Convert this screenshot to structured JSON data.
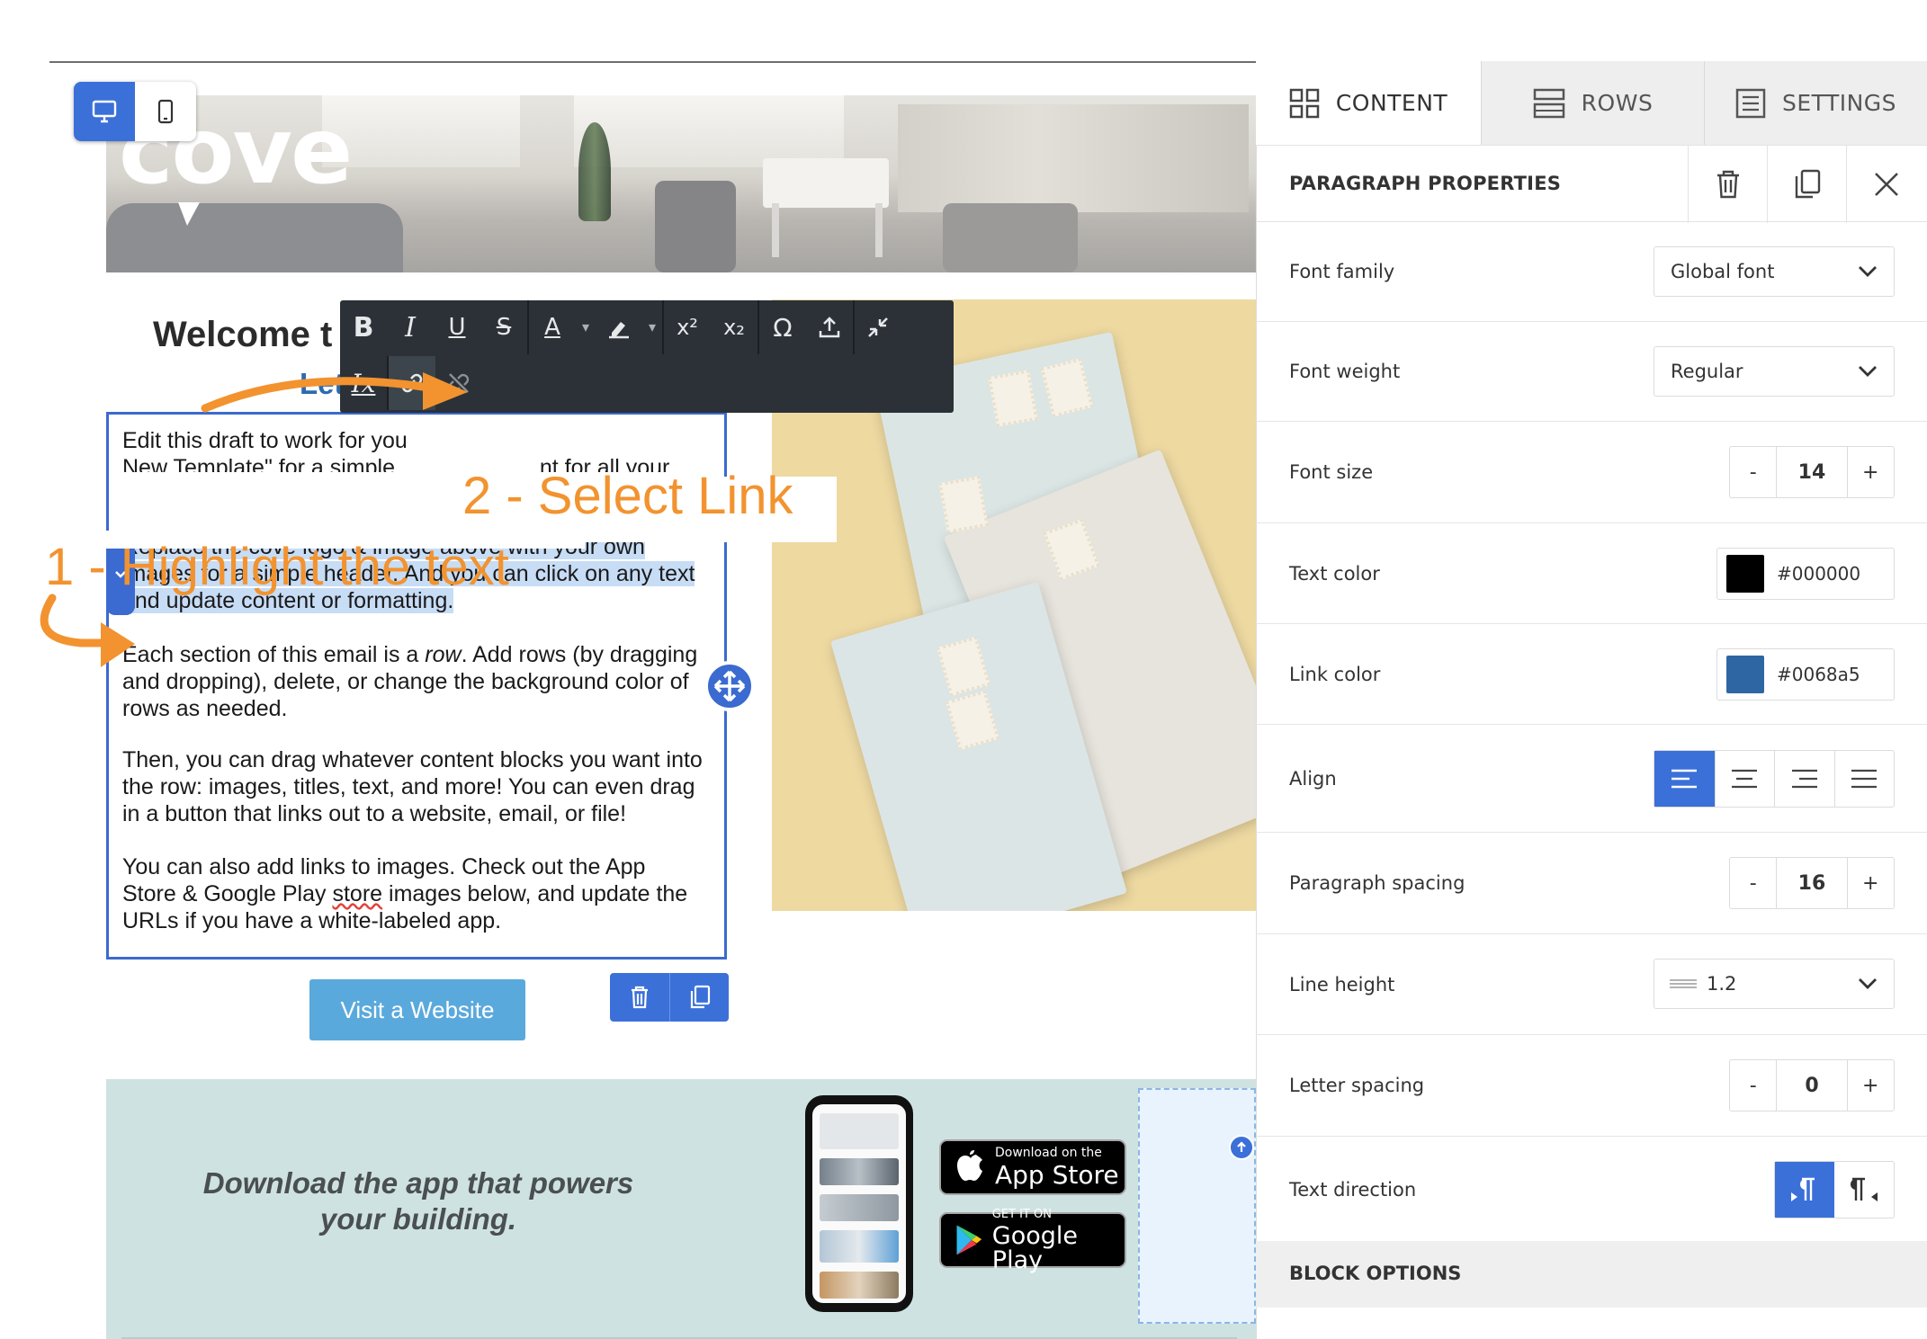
{
  "canvas": {
    "logo_text": "cove",
    "welcome_heading": "Welcome t",
    "subheading": "Let",
    "paragraphs": {
      "p1_line1": "Edit this draft to work for you",
      "p1_line2": "New Template\" for a simple",
      "p1_line2_tail": "...nt for all your",
      "p2_line1": "Replace the cove logo & image above with your own",
      "p2_line2": "images for a simple header. And you can click on any text",
      "p2_line3": "and update content or formatting.",
      "p3_before": "Each section of this email is a ",
      "p3_em": "row",
      "p3_after": ". Add rows (by dragging and dropping), delete, or change the background color of rows as needed.",
      "p4": "Then, you can drag whatever content blocks you want into the row: images, titles, text, and more! You can even drag in a button that links out to a website, email, or file!",
      "p5_before": "You can also add links to images. Check out the App Store & Google Play ",
      "p5_squiggle": "store",
      "p5_after": " images below, and update the URLs if you have a white-labeled app."
    },
    "visit_button": "Visit a Website",
    "app_row_text": "Download the app that powers your building.",
    "app_store_small": "Download on the",
    "app_store_big": "App Store",
    "google_small": "GET IT ON",
    "google_big": "Google Play"
  },
  "callouts": {
    "step1": "1 - Highlight the text",
    "step2": "2 - Select Link"
  },
  "toolbar": {
    "bold": "B",
    "italic": "I",
    "underline": "U",
    "strike": "S",
    "font_color": "A",
    "superscript": "x²",
    "subscript": "x₂",
    "special_char": "Ω",
    "clear_format": "Ix"
  },
  "panel": {
    "tabs": [
      {
        "label": "CONTENT",
        "icon": "grid-icon"
      },
      {
        "label": "ROWS",
        "icon": "rows-icon"
      },
      {
        "label": "SETTINGS",
        "icon": "settings-icon"
      }
    ],
    "section_title": "PARAGRAPH PROPERTIES",
    "font_family": {
      "label": "Font family",
      "value": "Global font"
    },
    "font_weight": {
      "label": "Font weight",
      "value": "Regular"
    },
    "font_size": {
      "label": "Font size",
      "value": "14",
      "minus": "-",
      "plus": "+"
    },
    "text_color": {
      "label": "Text color",
      "value": "#000000"
    },
    "link_color": {
      "label": "Link color",
      "value": "#0068a5"
    },
    "align": {
      "label": "Align",
      "selected": "left"
    },
    "paragraph_spacing": {
      "label": "Paragraph spacing",
      "value": "16",
      "minus": "-",
      "plus": "+"
    },
    "line_height": {
      "label": "Line height",
      "value": "1.2"
    },
    "letter_spacing": {
      "label": "Letter spacing",
      "value": "0",
      "minus": "-",
      "plus": "+"
    },
    "text_direction": {
      "label": "Text direction",
      "selected": "ltr"
    },
    "block_options": "BLOCK OPTIONS"
  },
  "colors": {
    "accent": "#3b70d9",
    "callout": "#f2932f",
    "text_color_swatch": "#000000",
    "link_color_swatch": "#2e66a3",
    "highlight": "#c7dcf5"
  }
}
